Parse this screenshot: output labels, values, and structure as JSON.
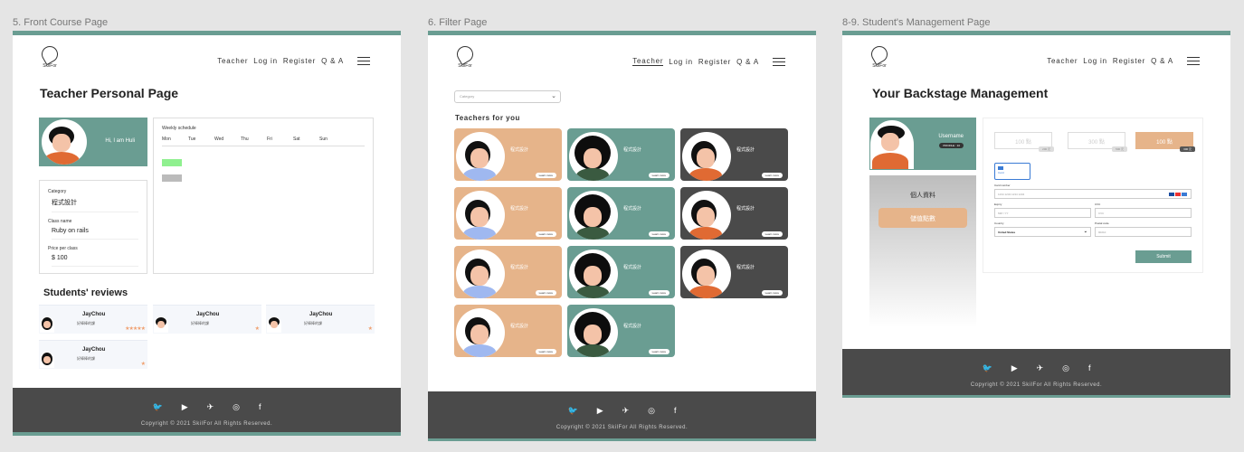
{
  "labels": {
    "frame1": "5. Front Course Page",
    "frame2": "6. Filter  Page",
    "frame3": "8-9. Student's Management Page"
  },
  "brand": {
    "logo_text": "SkilFor"
  },
  "nav": {
    "teacher": "Teacher",
    "login": "Log in",
    "register": "Register",
    "qa": "Q & A"
  },
  "footer": {
    "icons": [
      "twitter-icon",
      "youtube-icon",
      "telegram-icon",
      "instagram-icon",
      "facebook-icon"
    ],
    "glyphs": [
      "🐦",
      "▶",
      "✈",
      "◎",
      "f"
    ],
    "copyright": "Copyright © 2021 SkilFor All Rights Reserved."
  },
  "front": {
    "title": "Teacher Personal Page",
    "greeting": "Hi, I am Huli",
    "schedule_title": "Weekly schedule",
    "days": [
      "Mon",
      "Tue",
      "Wed",
      "Thu",
      "Fri",
      "Sat",
      "Sun"
    ],
    "category_label": "Category",
    "category_value": "程式設計",
    "class_label": "Class name",
    "class_value": "Ruby on rails",
    "price_label": "Price per class",
    "price_value": "$ 100",
    "reviews_title": "Students' reviews",
    "reviews": [
      {
        "name": "JayChou",
        "text": "好棒棒的課",
        "stars": "★★★★★"
      },
      {
        "name": "JayChou",
        "text": "好棒棒的課",
        "stars": "★"
      },
      {
        "name": "JayChou",
        "text": "好棒棒的課",
        "stars": "★"
      },
      {
        "name": "JayChou",
        "text": "好棒棒的課",
        "stars": "★"
      }
    ]
  },
  "filter": {
    "select_placeholder": "Category",
    "section_title": "Teachers for you",
    "card_title": "程式設計",
    "learn_more": "Learn more",
    "colors": {
      "peach": "#e6b48a",
      "teal": "#6a9d92",
      "dark": "#4a4a4a"
    }
  },
  "manage": {
    "title": "Your Backstage Management",
    "username": "Username",
    "badge": "PROFILE : 10",
    "menu_profile": "個人資料",
    "menu_wallet": "儲值點數",
    "prices": [
      "100 點",
      "300 點",
      "100 點"
    ],
    "price_tags": [
      "200 元",
      "500 元",
      "300 元"
    ],
    "card_option": "Card",
    "card_number_label": "Card number",
    "card_number_placeholder": "1234 1234 1234 1234",
    "expiry_label": "Expiry",
    "expiry_placeholder": "MM / YY",
    "cvc_label": "CVC",
    "cvc_placeholder": "CVC",
    "country_label": "Country",
    "country_value": "United States",
    "postal_label": "Postal code",
    "postal_placeholder": "90210",
    "submit": "Submit"
  }
}
